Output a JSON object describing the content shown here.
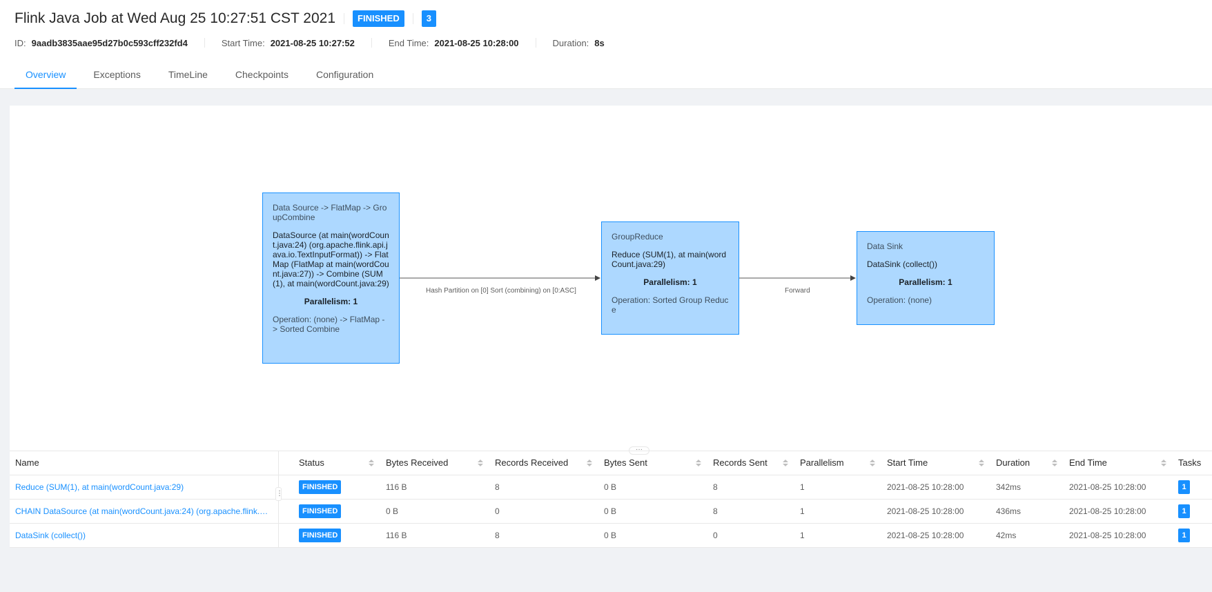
{
  "header": {
    "title": "Flink Java Job at Wed Aug 25 10:27:51 CST 2021",
    "status": "FINISHED",
    "task_count": "3",
    "meta": [
      {
        "label": "ID:",
        "value": "9aadb3835aae95d27b0c593cff232fd4"
      },
      {
        "label": "Start Time:",
        "value": "2021-08-25 10:27:52"
      },
      {
        "label": "End Time:",
        "value": "2021-08-25 10:28:00"
      },
      {
        "label": "Duration:",
        "value": "8s"
      }
    ]
  },
  "tabs": [
    {
      "label": "Overview",
      "active": true
    },
    {
      "label": "Exceptions",
      "active": false
    },
    {
      "label": "TimeLine",
      "active": false
    },
    {
      "label": "Checkpoints",
      "active": false
    },
    {
      "label": "Configuration",
      "active": false
    }
  ],
  "graph": {
    "nodes": [
      {
        "title": "Data Source -> FlatMap -> GroupCombine",
        "description": "DataSource (at main(wordCount.java:24) (org.apache.flink.api.java.io.TextInputFormat)) -> FlatMap (FlatMap at main(wordCount.java:27)) -> Combine (SUM(1), at main(wordCount.java:29)",
        "parallelism": "Parallelism: 1",
        "operation": "Operation: (none) -> FlatMap -> Sorted Combine"
      },
      {
        "title": "GroupReduce",
        "description": "Reduce (SUM(1), at main(wordCount.java:29)",
        "parallelism": "Parallelism: 1",
        "operation": "Operation: Sorted Group Reduce"
      },
      {
        "title": "Data Sink",
        "description": "DataSink (collect())",
        "parallelism": "Parallelism: 1",
        "operation": "Operation: (none)"
      }
    ],
    "edges": [
      {
        "label": "Hash Partition on [0] Sort (combining) on [0:ASC]"
      },
      {
        "label": "Forward"
      }
    ]
  },
  "table": {
    "columns": [
      "Name",
      "Status",
      "Bytes Received",
      "Records Received",
      "Bytes Sent",
      "Records Sent",
      "Parallelism",
      "Start Time",
      "Duration",
      "End Time",
      "Tasks"
    ],
    "rows": [
      {
        "name": "Reduce (SUM(1), at main(wordCount.java:29)",
        "status": "FINISHED",
        "bytes_received": "116 B",
        "records_received": "8",
        "bytes_sent": "0 B",
        "records_sent": "8",
        "parallelism": "1",
        "start_time": "2021-08-25 10:28:00",
        "duration": "342ms",
        "end_time": "2021-08-25 10:28:00",
        "tasks": "1"
      },
      {
        "name": "CHAIN DataSource (at main(wordCount.java:24) (org.apache.flink.api.java...",
        "status": "FINISHED",
        "bytes_received": "0 B",
        "records_received": "0",
        "bytes_sent": "0 B",
        "records_sent": "8",
        "parallelism": "1",
        "start_time": "2021-08-25 10:28:00",
        "duration": "436ms",
        "end_time": "2021-08-25 10:28:00",
        "tasks": "1"
      },
      {
        "name": "DataSink (collect())",
        "status": "FINISHED",
        "bytes_received": "116 B",
        "records_received": "8",
        "bytes_sent": "0 B",
        "records_sent": "0",
        "parallelism": "1",
        "start_time": "2021-08-25 10:28:00",
        "duration": "42ms",
        "end_time": "2021-08-25 10:28:00",
        "tasks": "1"
      }
    ]
  },
  "colors": {
    "accent": "#1890ff",
    "node_fill": "#add8ff"
  }
}
